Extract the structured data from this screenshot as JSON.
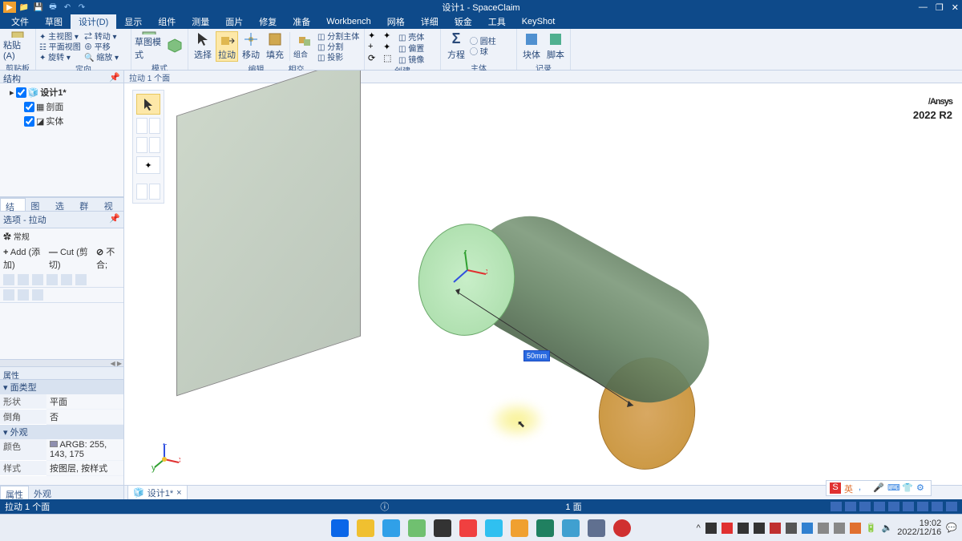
{
  "app": {
    "title": "设计1 - SpaceClaim",
    "qat_items": [
      "▶",
      "📁",
      "💾",
      "🖶",
      "↶",
      "↷"
    ]
  },
  "window_controls": {
    "min": "—",
    "max": "❐",
    "close": "✕"
  },
  "menubar": {
    "items": [
      "文件",
      "草图",
      "设计(D)",
      "显示",
      "组件",
      "测量",
      "面片",
      "修复",
      "准备",
      "Workbench",
      "网格",
      "详细",
      "钣金",
      "工具",
      "KeyShot"
    ],
    "active_index": 2
  },
  "ribbon": {
    "groups": [
      {
        "label": "剪贴板",
        "large": [
          {
            "label": "粘贴 (A)"
          }
        ]
      },
      {
        "label": "定向",
        "cols": [
          [
            "✦ 主视图 ▾",
            "☷ 平面视图",
            "✦ 旋转 ▾"
          ],
          [
            "⇄ 转动 ▾",
            "⊕ 平移",
            "🔍 缩放 ▾"
          ]
        ]
      },
      {
        "label": "模式",
        "large": [
          {
            "label": "草图模式"
          },
          {
            "label": ""
          }
        ]
      },
      {
        "label": "编辑",
        "large": [
          {
            "label": "选择"
          },
          {
            "label": "拉动",
            "active": true
          },
          {
            "label": "移动"
          },
          {
            "label": "填充"
          }
        ],
        "cols_after": [
          [
            "组合",
            "投影"
          ],
          [
            "◫ 分割主体",
            "◫ 分割",
            "◫ 投影"
          ]
        ],
        "sub_label": "相交"
      },
      {
        "label": "创建",
        "small_grid": [
          "✦",
          "✦",
          "◫ 壳体",
          "+",
          "✦",
          "◫ 偏置",
          "⟳",
          "⬚",
          "◫ 镜像"
        ]
      },
      {
        "label": "主体",
        "large": [
          {
            "label": "方程"
          }
        ],
        "cols_after": [
          [
            "◯ 圆柱",
            "◯ 球"
          ]
        ]
      },
      {
        "label": "记录",
        "large": [
          {
            "label": "块体"
          },
          {
            "label": "脚本"
          }
        ]
      }
    ]
  },
  "left": {
    "struct_header": "结构",
    "tree": {
      "root": "设计1*",
      "children": [
        "剖面",
        "实体"
      ]
    },
    "mid_tabs": [
      "结构",
      "图层",
      "选择",
      "群组",
      "视图"
    ],
    "mid_active": 0,
    "options_header": "选项 - 拉动",
    "options_general": "✿ 常规",
    "options_ops": [
      {
        "icon": "+",
        "label": "Add (添加)"
      },
      {
        "icon": "—",
        "label": "Cut (剪切)"
      },
      {
        "icon": "⊘",
        "label": "不合;"
      }
    ],
    "props_header": "属性",
    "props": [
      {
        "section": "面类型",
        "rows": [
          {
            "k": "形状",
            "v": "平面"
          },
          {
            "k": "倒角",
            "v": "否"
          }
        ]
      },
      {
        "section": "外观",
        "rows": [
          {
            "k": "颜色",
            "v": "ARGB: 255, 143, 175"
          },
          {
            "k": "样式",
            "v": "按图层, 按样式"
          }
        ]
      }
    ],
    "bottom_tabs": [
      "属性",
      "外观"
    ],
    "bottom_active": 0
  },
  "viewport": {
    "header": "拉动 1 个面",
    "dim_label": "50mm",
    "brand": "Ansys",
    "brand_ver": "2022 R2",
    "doc_tab": "设计1*"
  },
  "statusbar": {
    "left": "拉动 1 个面",
    "info_icon": "ⓘ",
    "selection": "1 面"
  },
  "ime": {
    "items": [
      "S",
      "英",
      ",",
      "🎤",
      "⌨",
      "👕",
      "⚙"
    ]
  },
  "taskbar": {
    "apps": [
      "#0a66e8",
      "#f0c030",
      "#30a0e8",
      "#70c070",
      "#333",
      "#f04040",
      "#30c0f0",
      "#f0a030",
      "#208060",
      "#40a0d0",
      "#607090",
      "#d03030"
    ],
    "tray_icons": [
      "^",
      "👤",
      "S",
      "⬚",
      "⬚",
      "⬚",
      "⬚",
      "🅾",
      "⚙",
      "📋",
      "S",
      "🔋",
      "🔈"
    ],
    "time": "19:02",
    "date": "2022/12/16"
  },
  "colors": {
    "title_bg": "#0e4a8a"
  }
}
